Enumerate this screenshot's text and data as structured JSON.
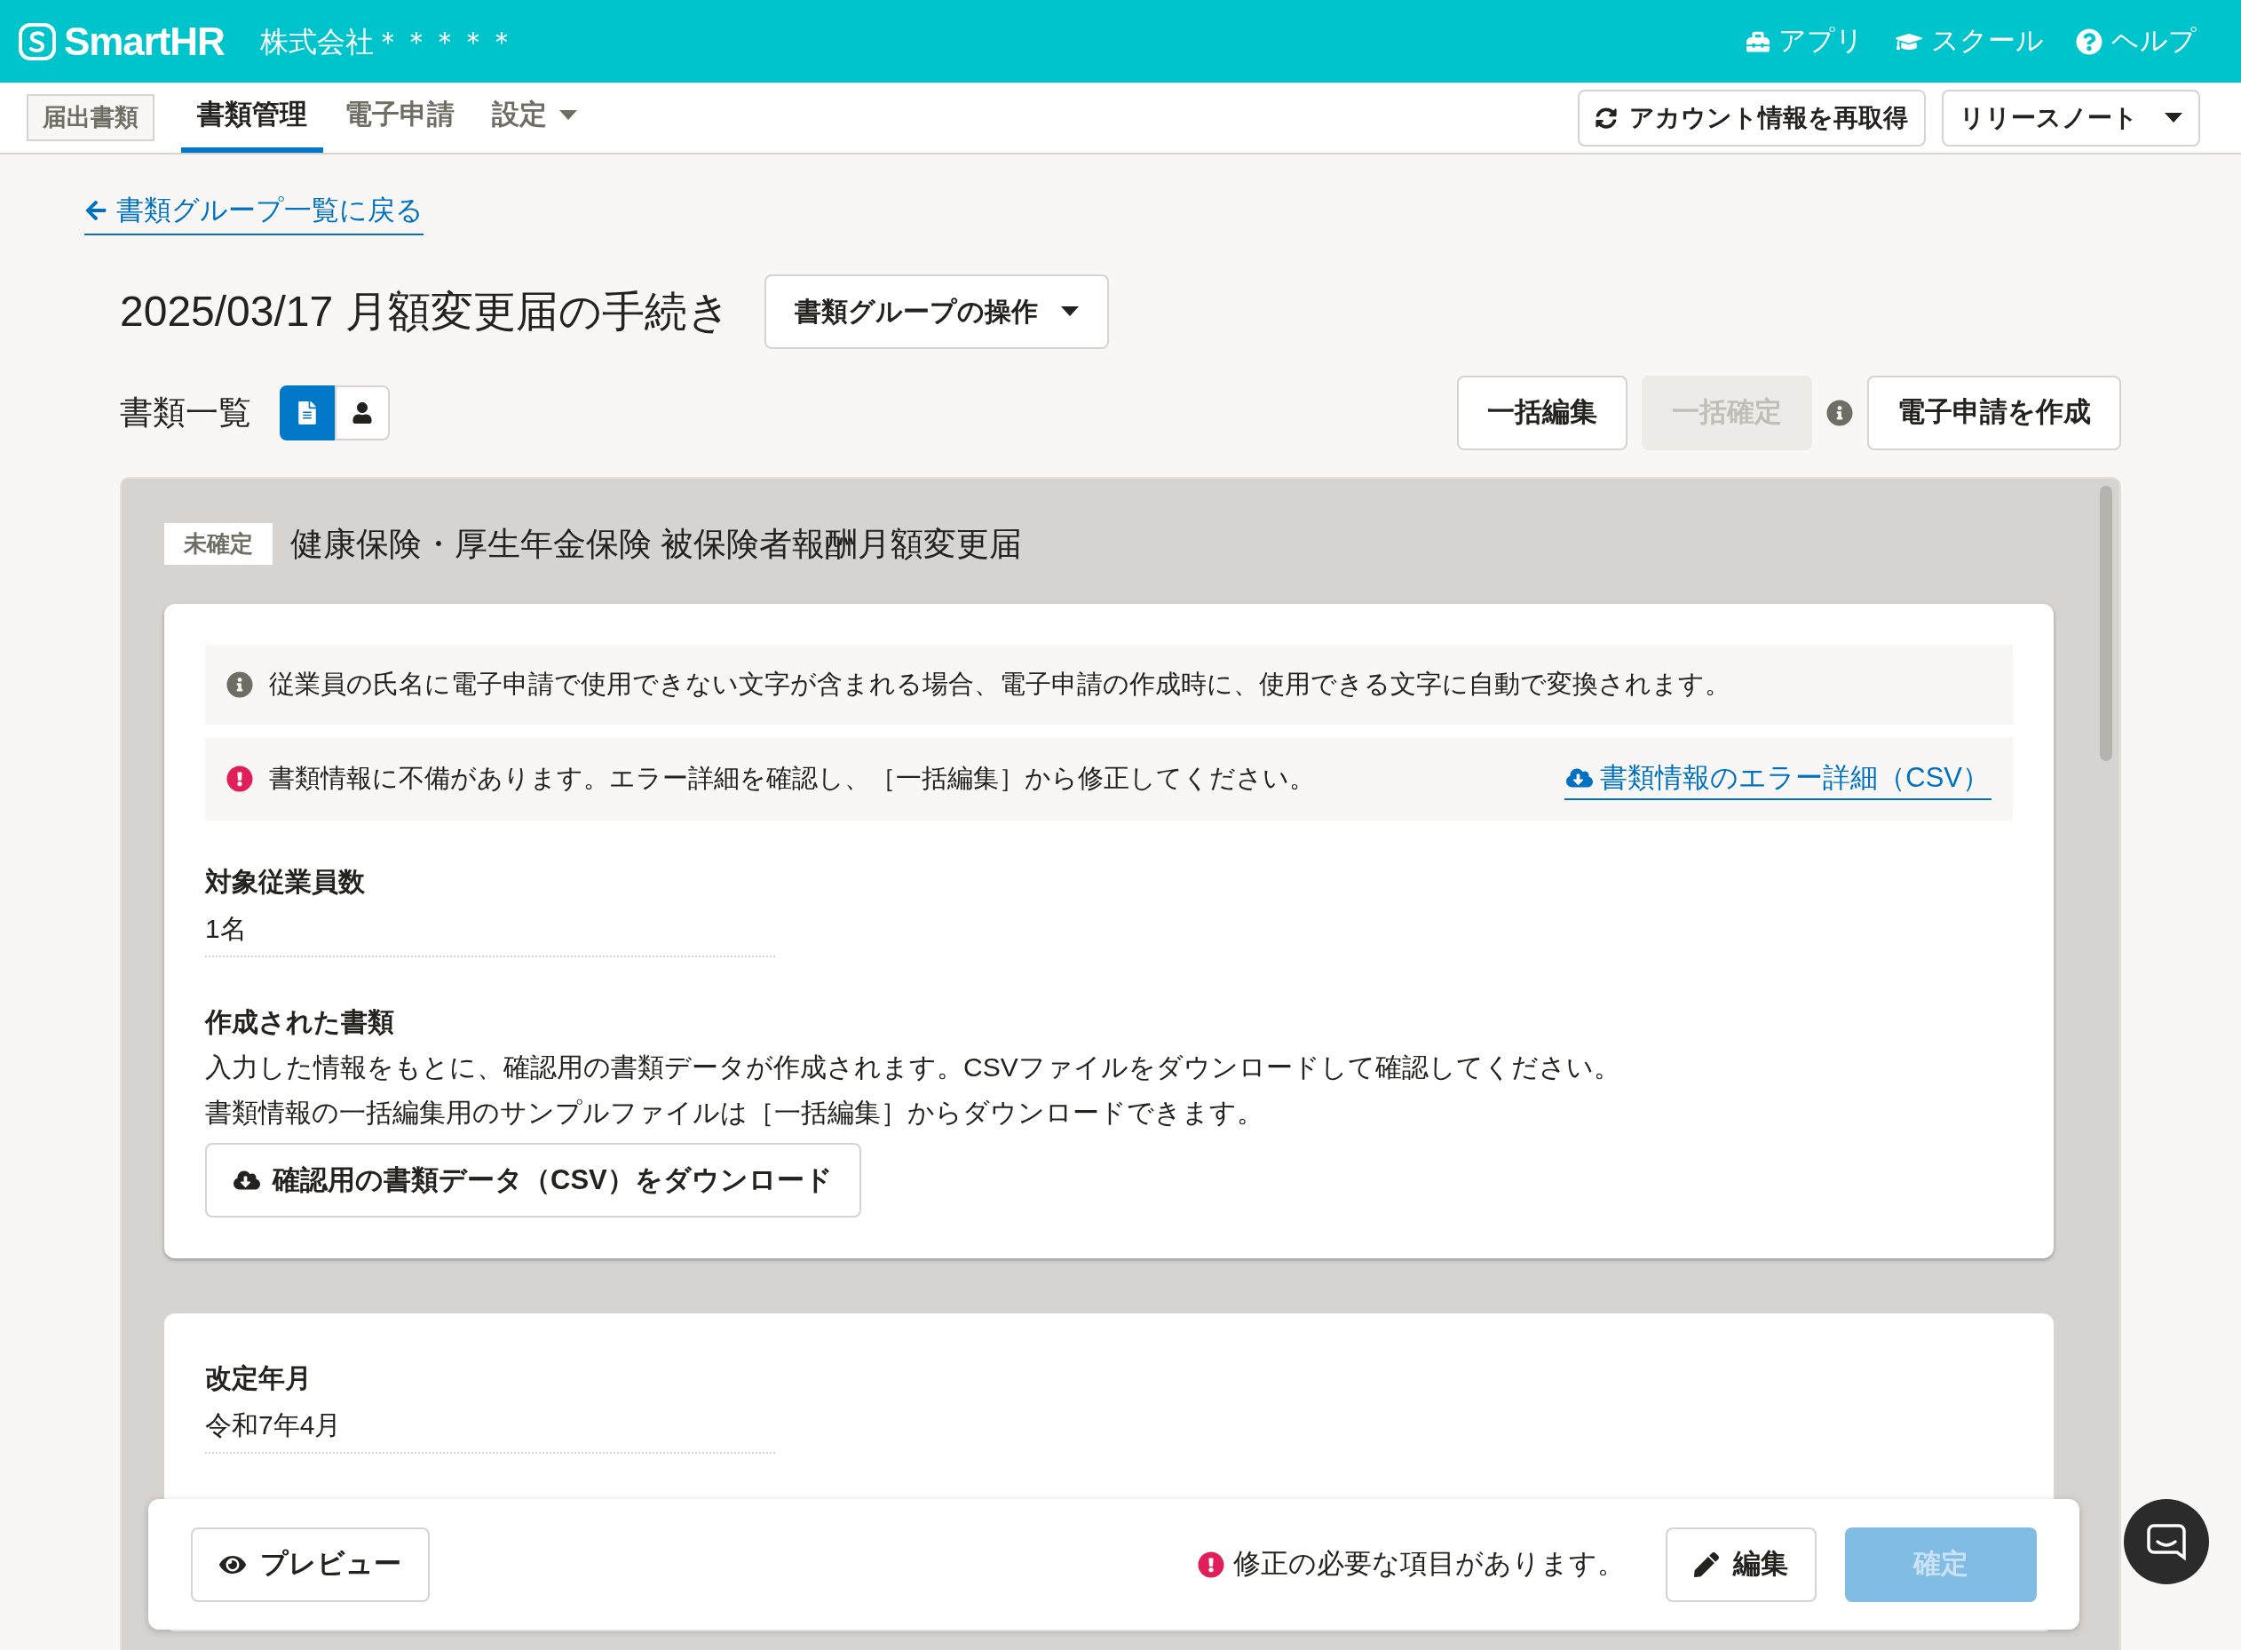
{
  "header": {
    "logo": "SmartHR",
    "company": "株式会社＊＊＊＊＊",
    "links": [
      {
        "kind": "toolbox",
        "label": "アプリ"
      },
      {
        "kind": "school",
        "label": "スクール"
      },
      {
        "kind": "help",
        "label": "ヘルプ"
      }
    ]
  },
  "nav": {
    "section": "届出書類",
    "tabs": [
      {
        "label": "書類管理",
        "selected": true,
        "has_menu": false
      },
      {
        "label": "電子申請",
        "selected": false,
        "has_menu": false
      },
      {
        "label": "設定",
        "selected": false,
        "has_menu": true
      }
    ],
    "buttons": [
      {
        "kind": "refresh",
        "label": "アカウント情報を再取得"
      },
      {
        "kind": "menu",
        "label": "リリースノート"
      }
    ]
  },
  "back_link": "書類グループ一覧に戻る",
  "page_title": "2025/03/17 月額変更届の手続き",
  "group_menu_button": "書類グループの操作",
  "list_title": "書類一覧",
  "view_toggle": [
    {
      "kind": "document",
      "selected": true
    },
    {
      "kind": "person",
      "selected": false
    }
  ],
  "actions": [
    {
      "label": "一括編集",
      "disabled": false,
      "info": false
    },
    {
      "label": "一括確定",
      "disabled": true,
      "info": true
    },
    {
      "label": "電子申請を作成",
      "disabled": false,
      "info": false
    }
  ],
  "document": {
    "status": "未確定",
    "title": "健康保険・厚生年金保険 被保険者報酬月額変更届",
    "notices": [
      {
        "kind": "info",
        "text": "従業員の氏名に電子申請で使用できない文字が含まれる場合、電子申請の作成時に、使用できる文字に自動で変換されます。"
      },
      {
        "kind": "error",
        "text": "書類情報に不備があります。エラー詳細を確認し、［一括編集］から修正してください。",
        "link": "書類情報のエラー詳細（CSV）"
      }
    ],
    "fields": [
      {
        "label": "対象従業員数",
        "value": "1名"
      }
    ],
    "created": {
      "label": "作成された書類",
      "lines": [
        "入力した情報をもとに、確認用の書類データが作成されます。CSVファイルをダウンロードして確認してください。",
        "書類情報の一括編集用のサンプルファイルは［一括編集］からダウンロードできます。"
      ],
      "button": "確認用の書類データ（CSV）をダウンロード"
    },
    "detail_fields": [
      {
        "label": "改定年月",
        "value": "令和7年4月"
      }
    ]
  },
  "footer": {
    "preview": "プレビュー",
    "message": "修正の必要な項目があります。",
    "edit": "編集",
    "confirm": {
      "label": "確定",
      "disabled": true
    }
  }
}
